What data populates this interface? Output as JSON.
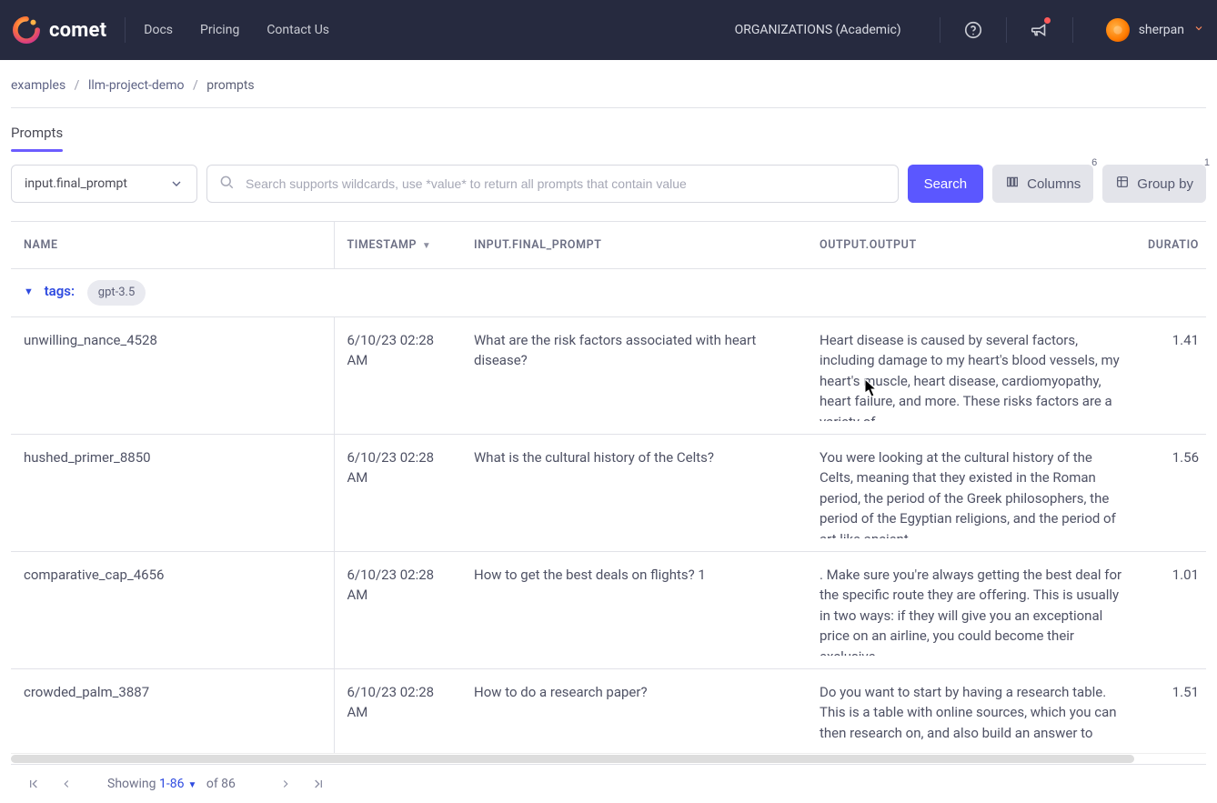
{
  "brand": {
    "name": "comet"
  },
  "nav": {
    "links": [
      "Docs",
      "Pricing",
      "Contact Us"
    ],
    "org_label": "ORGANIZATIONS (Academic)",
    "user": "sherpan"
  },
  "breadcrumbs": [
    "examples",
    "llm-project-demo",
    "prompts"
  ],
  "tab": {
    "prompts": "Prompts"
  },
  "controls": {
    "select_value": "input.final_prompt",
    "search_placeholder": "Search supports wildcards, use *value* to return all prompts that contain value",
    "search_button": "Search",
    "columns_label": "Columns",
    "columns_badge": "6",
    "groupby_label": "Group by",
    "groupby_badge": "1"
  },
  "columns": {
    "name": "NAME",
    "timestamp": "TIMESTAMP",
    "input": "INPUT.FINAL_PROMPT",
    "output": "OUTPUT.OUTPUT",
    "duration": "DURATIO"
  },
  "group": {
    "label": "tags:",
    "tag": "gpt-3.5"
  },
  "rows": [
    {
      "name": "unwilling_nance_4528",
      "ts": "6/10/23 02:28 AM",
      "input": "What are the risk factors associated with heart disease?",
      "output": "Heart disease is caused by several factors, including damage to my heart's blood vessels, my heart's muscle, heart disease, cardiomyopathy, heart failure, and more. These risks factors are a variety of…",
      "dur": "1.41"
    },
    {
      "name": "hushed_primer_8850",
      "ts": "6/10/23 02:28 AM",
      "input": "What is the cultural history of the Celts?",
      "output": "You were looking at the cultural history of the Celts, meaning that they existed in the Roman period, the period of the Greek philosophers, the period of the Egyptian religions, and the period of art like ancient…",
      "dur": "1.56"
    },
    {
      "name": "comparative_cap_4656",
      "ts": "6/10/23 02:28 AM",
      "input": "How to get the best deals on flights? 1",
      "output": ". Make sure you're always getting the best deal for the specific route they are offering. This is usually in two ways: if they will give you an exceptional price on an airline, you could become their exclusive…",
      "dur": "1.01"
    },
    {
      "name": "crowded_palm_3887",
      "ts": "6/10/23 02:28 AM",
      "input": "How to do a research paper?",
      "output": "Do you want to start by having a research table. This is a table with online sources, which you can then research on, and also build an answer to research",
      "dur": "1.51"
    }
  ],
  "pagination": {
    "showing": "Showing",
    "range": "1-86",
    "of": "of 86"
  }
}
